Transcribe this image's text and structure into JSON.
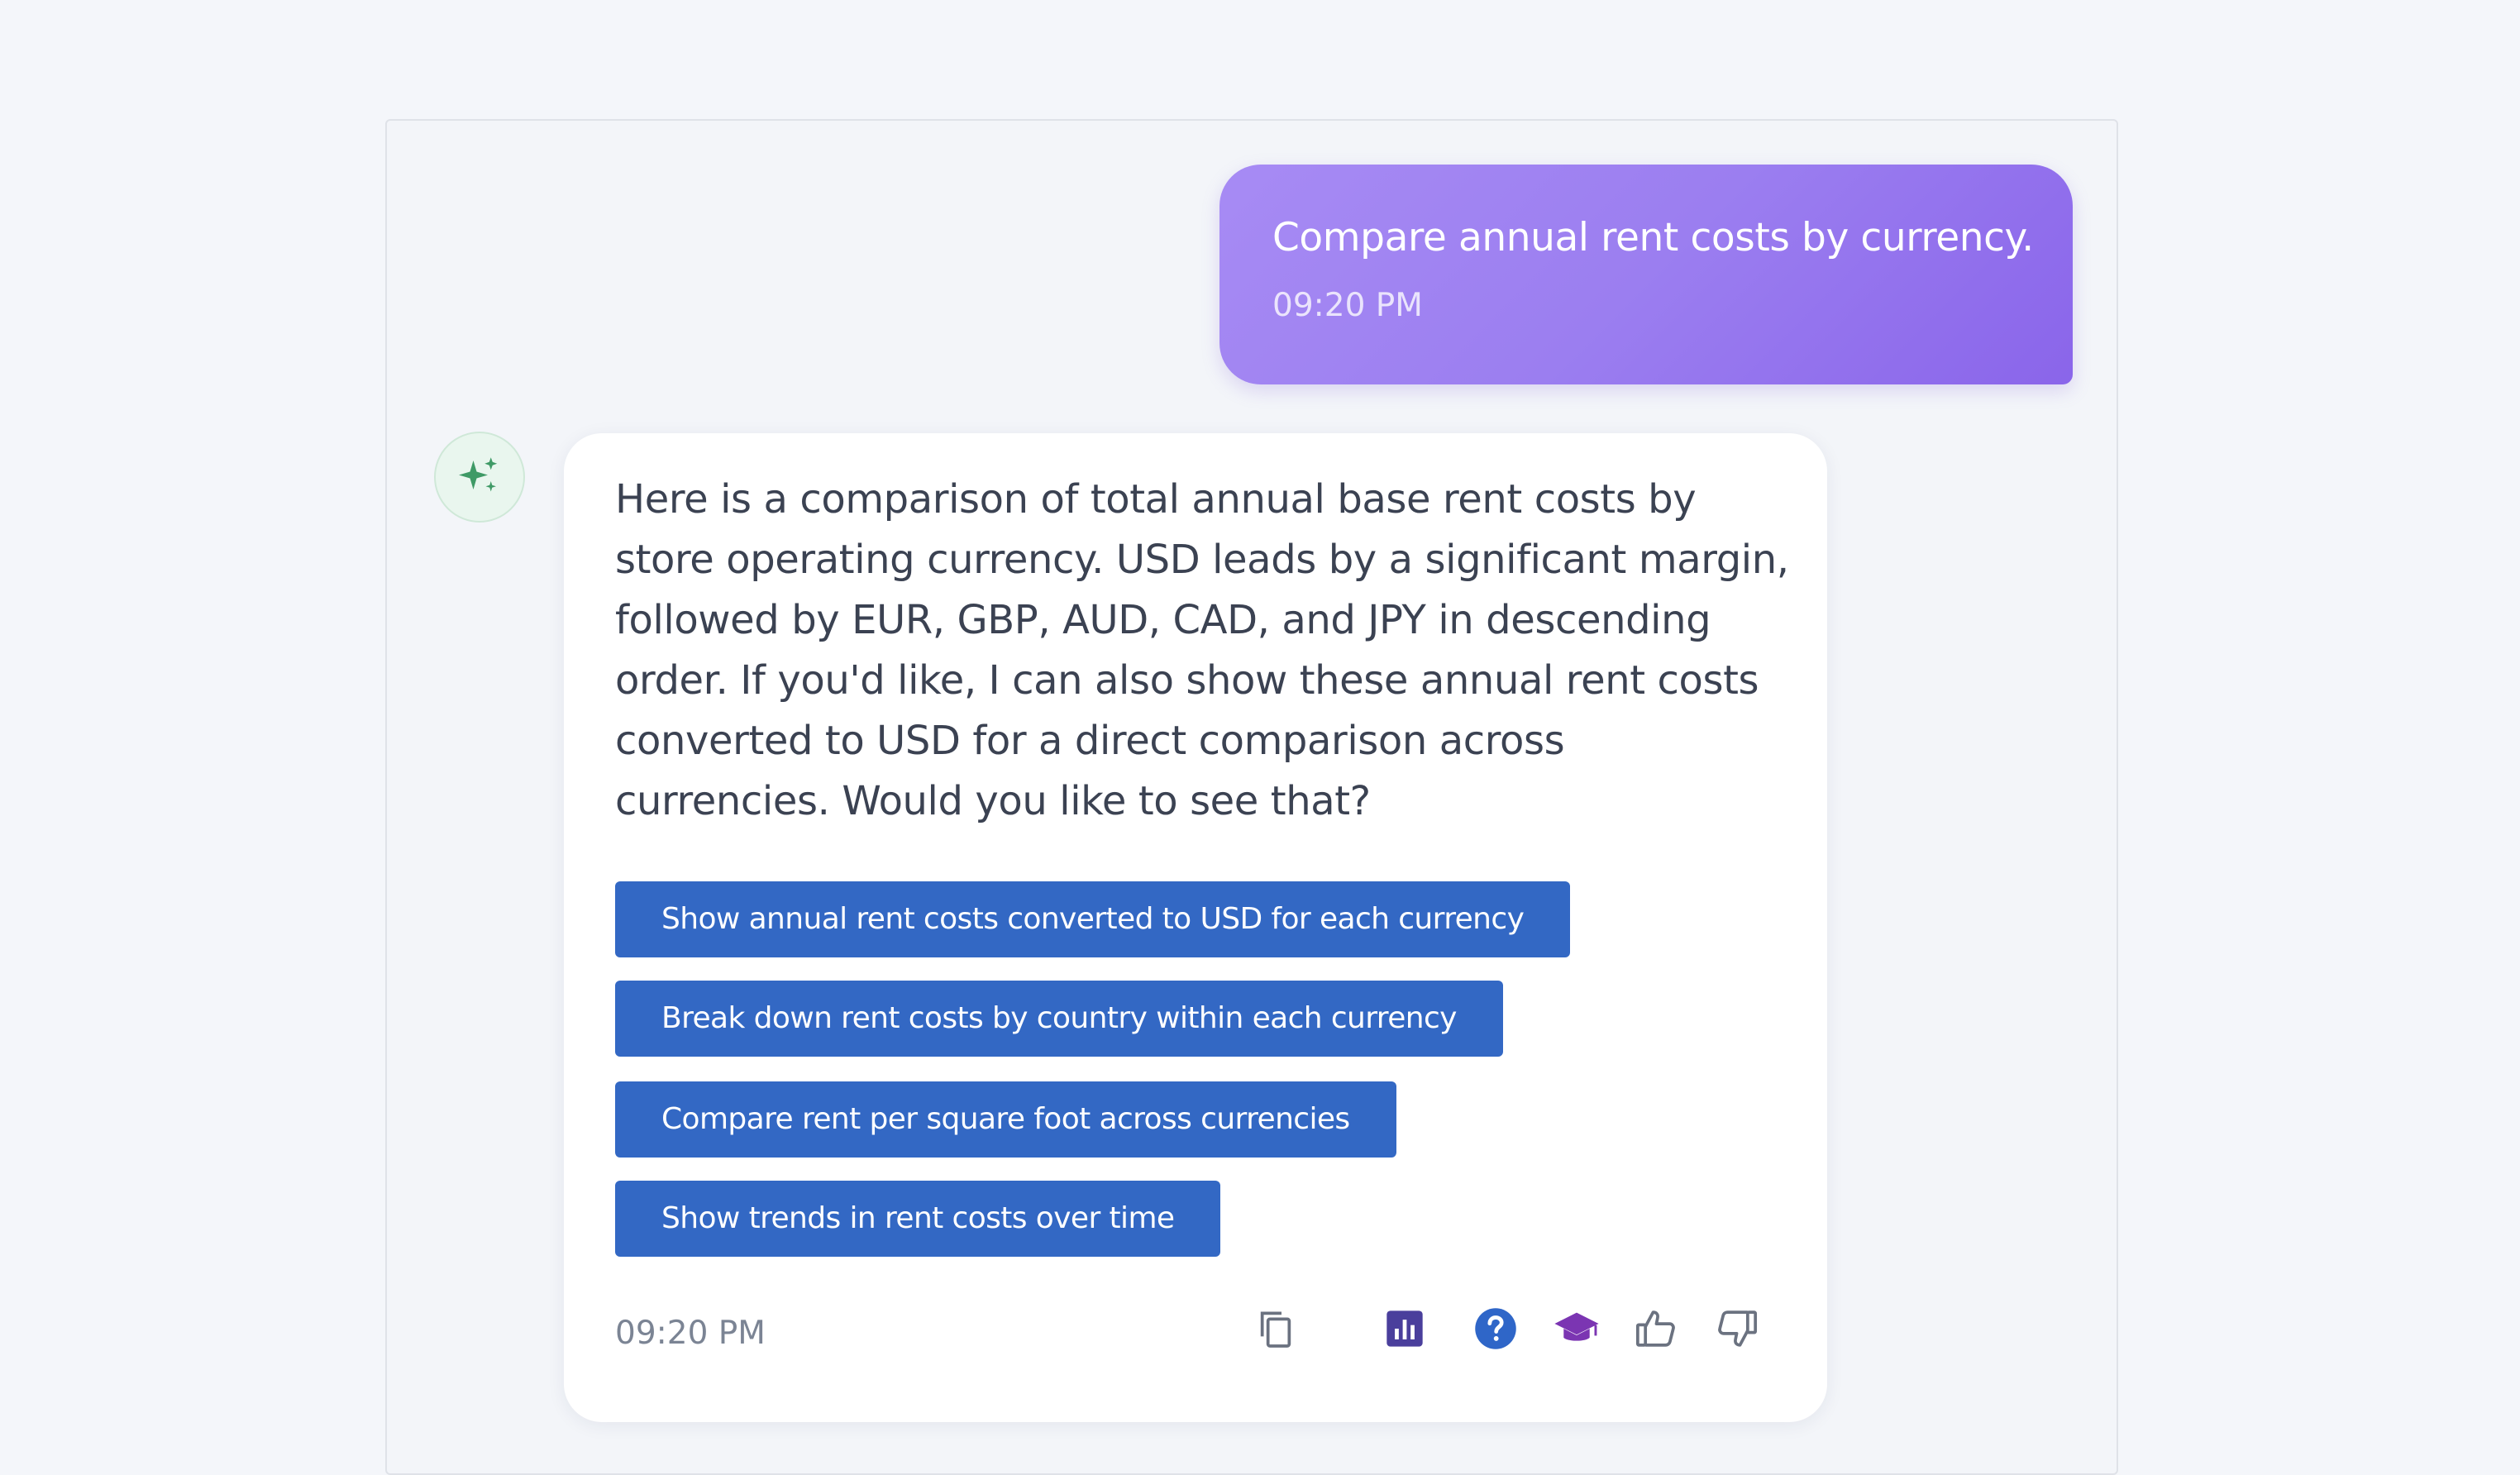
{
  "user_message": {
    "text": "Compare annual rent costs by currency.",
    "time": "09:20 PM"
  },
  "assistant_message": {
    "avatar_icon": "sparkle-icon",
    "text": "Here is a comparison of total annual base rent costs by store operating currency. USD leads by a significant margin, followed by EUR, GBP, AUD, CAD, and JPY in descending order. If you'd like, I can also show these annual rent costs converted to USD for a direct comparison across currencies. Would you like to see that?",
    "suggestions": [
      {
        "label": "Show annual rent costs converted to USD for each currency"
      },
      {
        "label": "Break down rent costs by country within each currency"
      },
      {
        "label": "Compare rent per square foot across currencies"
      },
      {
        "label": "Show trends in rent costs over time"
      }
    ],
    "time": "09:20 PM",
    "actions": [
      {
        "icon": "copy-icon",
        "color": "#6b7280"
      },
      {
        "icon": "chart-icon",
        "color": "#4a3f9c"
      },
      {
        "icon": "help-icon",
        "color": "#2f66c8"
      },
      {
        "icon": "graduation-cap-icon",
        "color": "#7b35b2"
      },
      {
        "icon": "thumbs-up-icon",
        "color": "#6b7280"
      },
      {
        "icon": "thumbs-down-icon",
        "color": "#6b7280"
      }
    ]
  },
  "colors": {
    "user_bubble": "#9b7ef0",
    "suggestion_button": "#3368c4",
    "avatar_accent": "#3f9a66"
  }
}
